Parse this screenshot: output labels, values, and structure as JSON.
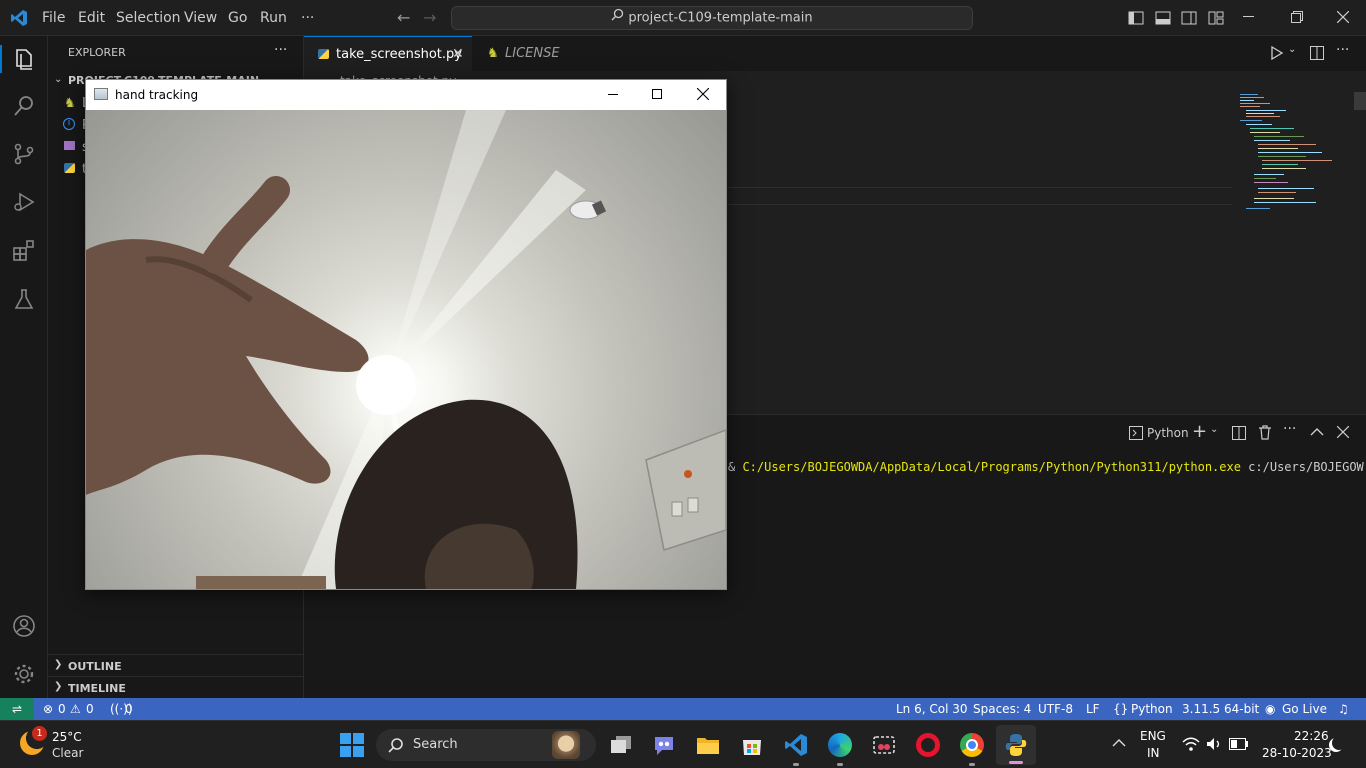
{
  "menu": [
    "File",
    "Edit",
    "Selection",
    "View",
    "Go",
    "Run",
    "···"
  ],
  "search": {
    "text": "project-C109-template-main"
  },
  "explorer": {
    "title": "EXPLORER",
    "project": "PROJECT-C109-TEMPLATE-MAIN",
    "files": [
      "L",
      "R",
      "s",
      "t"
    ],
    "outline": "OUTLINE",
    "timeline": "TIMELINE"
  },
  "tabs": [
    {
      "label": "take_screenshot.py",
      "active": true
    },
    {
      "label": "LICENSE",
      "active": false
    }
  ],
  "breadcrumb": "take_screenshot.py",
  "terminal": {
    "profile": "Python",
    "command_prefix": "& ",
    "command_path": "C:/Users/BOJEGOWDA/AppData/Local/Programs/Python/Python311/python.exe",
    "command_arg": " c:/Users/BOJEGOW"
  },
  "hand_window": {
    "title": "hand tracking"
  },
  "status": {
    "errors": "0",
    "warnings": "0",
    "ports": "0",
    "position": "Ln 6, Col 30",
    "spaces": "Spaces: 4",
    "encoding": "UTF-8",
    "eol": "LF",
    "language": "Python",
    "interpreter": "3.11.5 64-bit",
    "golive": "Go Live"
  },
  "taskbar": {
    "weather_temp": "25°C",
    "weather_desc": "Clear",
    "weather_badge": "1",
    "search": "Search",
    "lang_top": "ENG",
    "lang_bottom": "IN",
    "time": "22:26",
    "date": "28-10-2023"
  },
  "colors": {
    "statusbar": "#3a66c2",
    "accent": "#0078d4",
    "terminal_path": "#e5e510"
  }
}
